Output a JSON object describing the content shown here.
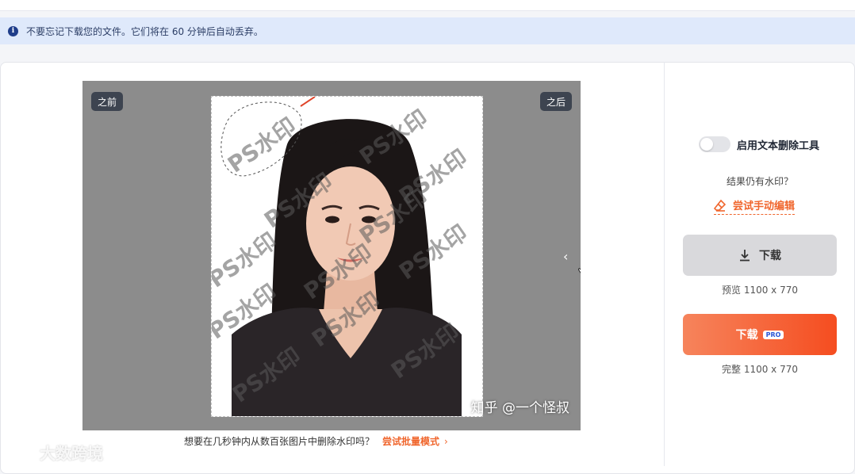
{
  "notice": {
    "text": "不要忘记下载您的文件。它们将在 60 分钟后自动丢弃。"
  },
  "editor": {
    "before_label": "之前",
    "after_label": "之后",
    "watermark_text": "PS水印",
    "credit_text": "知乎 @一个怪叔",
    "slider_arrow": "‹"
  },
  "batch": {
    "prompt": "想要在几秒钟内从数百张图片中删除水印吗？",
    "link": "尝试批量模式",
    "chevron": "›"
  },
  "brand": {
    "text": "大数跨境"
  },
  "sidebar": {
    "toggle_label": "启用文本删除工具",
    "toggle_on": false,
    "still_watermark": "结果仍有水印？",
    "manual_edit": "尝试手动编辑",
    "download_label": "下载",
    "preview_text": "预览 1100 x 770",
    "pro_download_label": "下载",
    "pro_badge": "PRO",
    "full_text": "完整 1100 x 770"
  },
  "colors": {
    "accent": "#f0662d",
    "notice_bg": "#dfe9fb",
    "pro_gradient_start": "#f6845c",
    "pro_gradient_end": "#f54d20",
    "canvas_bg": "#8c8c8c"
  }
}
